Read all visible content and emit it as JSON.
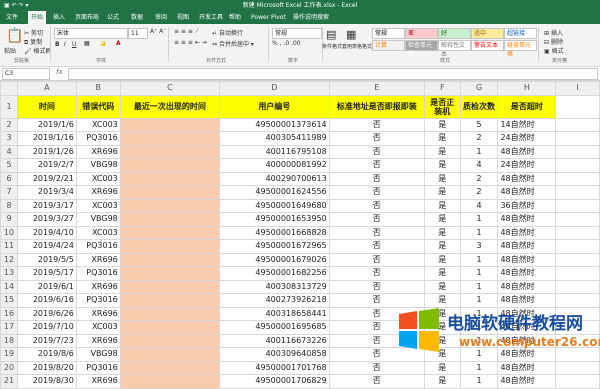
{
  "window": {
    "title": "新建 Microsoft Excel 工作表.xlsx - Excel",
    "tabs": [
      "文件",
      "开始",
      "插入",
      "页面布局",
      "公式",
      "数据",
      "审阅",
      "视图",
      "开发工具",
      "帮助",
      "Power Pivot",
      "操作说明搜索"
    ],
    "active_tab": "开始"
  },
  "ribbon": {
    "clipboard": {
      "paste": "粘贴",
      "cut": "剪切",
      "copy": "复制",
      "format_painter": "格式刷",
      "group": "剪贴板"
    },
    "font": {
      "name": "宋体",
      "size": "11",
      "group": "字体"
    },
    "alignment": {
      "wrap": "自动换行",
      "merge": "合并后居中",
      "group": "对齐方式"
    },
    "number": {
      "format": "常规",
      "group": "数字"
    },
    "styles": {
      "conditional": "条件格式",
      "table": "套用表格格式",
      "group": "样式",
      "cells": [
        {
          "label": "常规",
          "bg": "#ffffff",
          "fg": "#000000"
        },
        {
          "label": "差",
          "bg": "#ffc7ce",
          "fg": "#9c0006"
        },
        {
          "label": "好",
          "bg": "#c6efce",
          "fg": "#006100"
        },
        {
          "label": "适中",
          "bg": "#ffeb9c",
          "fg": "#9c5700"
        },
        {
          "label": "超链接",
          "bg": "#ffffff",
          "fg": "#0563c1"
        },
        {
          "label": "计算",
          "bg": "#f2f2f2",
          "fg": "#fa7d00"
        },
        {
          "label": "检查单元格",
          "bg": "#a5a5a5",
          "fg": "#ffffff"
        },
        {
          "label": "解释性文本",
          "bg": "#ffffff",
          "fg": "#7f7f7f"
        },
        {
          "label": "警告文本",
          "bg": "#ffffff",
          "fg": "#ff0000"
        },
        {
          "label": "链接单元格",
          "bg": "#ffffff",
          "fg": "#fa7d00"
        }
      ]
    },
    "cells_group": {
      "insert": "插入",
      "delete": "删除",
      "format": "格式",
      "group": "单元格"
    }
  },
  "formula_bar": {
    "name_box": "C3",
    "fx": "fx",
    "value": ""
  },
  "columns": [
    "A",
    "B",
    "C",
    "D",
    "E",
    "F",
    "G",
    "H",
    "I"
  ],
  "header_row": [
    "时间",
    "错误代码",
    "最近一次出现的时间",
    "用户编号",
    "标准地址是否即报即装",
    "是否正装机",
    "质检次数",
    "是否超时"
  ],
  "rows": [
    [
      "2019/1/6",
      "XC003",
      "",
      "49500001373614",
      "否",
      "是",
      "5",
      "14自然时"
    ],
    [
      "2019/1/16",
      "PQ3016",
      "",
      "400305411989",
      "否",
      "是",
      "2",
      "24自然时"
    ],
    [
      "2019/1/26",
      "XR696",
      "",
      "400116795108",
      "否",
      "是",
      "1",
      "48自然时"
    ],
    [
      "2019/2/7",
      "VBG98",
      "",
      "400000081992",
      "否",
      "是",
      "4",
      "24自然时"
    ],
    [
      "2019/2/21",
      "XC003",
      "",
      "400290700613",
      "否",
      "是",
      "2",
      "48自然时"
    ],
    [
      "2019/3/4",
      "XR696",
      "",
      "49500001624556",
      "否",
      "是",
      "2",
      "48自然时"
    ],
    [
      "2019/3/17",
      "XC003",
      "",
      "49500001649680",
      "否",
      "是",
      "4",
      "36自然时"
    ],
    [
      "2019/3/27",
      "VBG98",
      "",
      "49500001653950",
      "否",
      "是",
      "1",
      "48自然时"
    ],
    [
      "2019/4/10",
      "XC003",
      "",
      "49500001668828",
      "否",
      "是",
      "1",
      "48自然时"
    ],
    [
      "2019/4/24",
      "PQ3016",
      "",
      "49500001672965",
      "否",
      "是",
      "3",
      "48自然时"
    ],
    [
      "2019/5/5",
      "XR696",
      "",
      "49500001679026",
      "否",
      "是",
      "1",
      "48自然时"
    ],
    [
      "2019/5/17",
      "PQ3016",
      "",
      "49500001682256",
      "否",
      "是",
      "1",
      "48自然时"
    ],
    [
      "2019/6/1",
      "XR696",
      "",
      "400308313729",
      "否",
      "是",
      "1",
      "48自然时"
    ],
    [
      "2019/6/16",
      "PQ3016",
      "",
      "400273926218",
      "否",
      "是",
      "1",
      "48自然时"
    ],
    [
      "2019/6/26",
      "XR696",
      "",
      "400318658441",
      "否",
      "是",
      "1",
      "48自然时"
    ],
    [
      "2019/7/10",
      "XC003",
      "",
      "49500001695685",
      "否",
      "是",
      "1",
      "48自然时"
    ],
    [
      "2019/7/23",
      "XR696",
      "",
      "400116673226",
      "否",
      "是",
      "1",
      "48自然时"
    ],
    [
      "2019/8/6",
      "VBG98",
      "",
      "400309640858",
      "否",
      "是",
      "1",
      "48自然时"
    ],
    [
      "2019/8/20",
      "PQ3016",
      "",
      "49500001701768",
      "否",
      "是",
      "1",
      "48自然时"
    ],
    [
      "2019/8/30",
      "XR696",
      "",
      "49500001706829",
      "否",
      "是",
      "1",
      "48自然时"
    ]
  ],
  "watermark": {
    "line1": "电脑软硬件教程网",
    "line2": "www.computer26.com"
  }
}
